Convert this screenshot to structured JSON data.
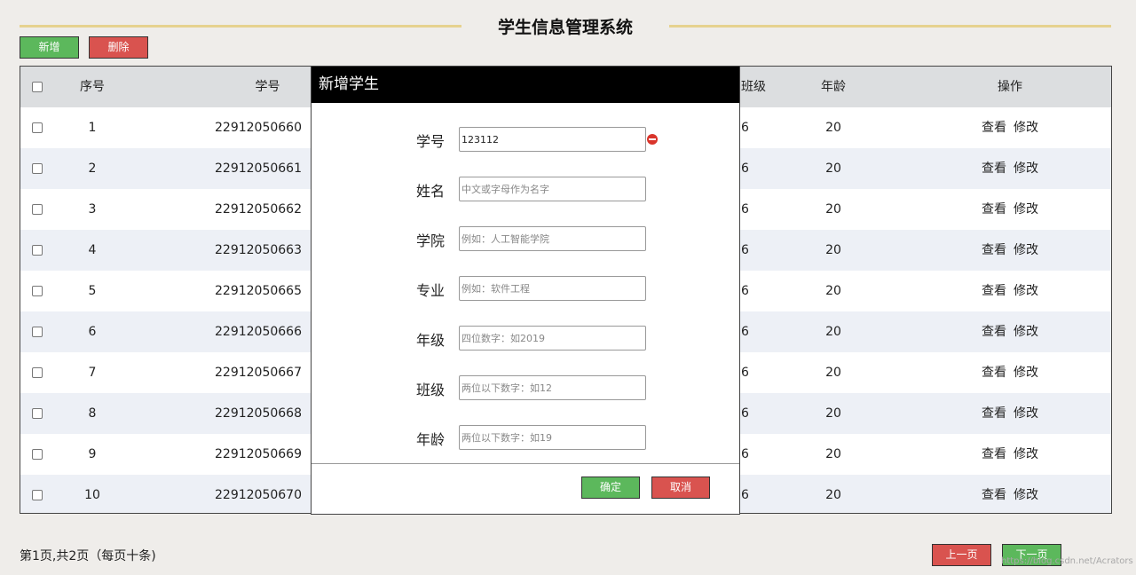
{
  "title": "学生信息管理系统",
  "toolbar": {
    "add_label": "新增",
    "delete_label": "删除"
  },
  "table": {
    "headers": {
      "seq": "序号",
      "student_id": "学号",
      "class": "班级",
      "age": "年龄",
      "ops": "操作"
    },
    "rows": [
      {
        "seq": "1",
        "student_id": "22912050660",
        "class": "6",
        "age": "20",
        "view": "查看",
        "edit": "修改"
      },
      {
        "seq": "2",
        "student_id": "22912050661",
        "class": "6",
        "age": "20",
        "view": "查看",
        "edit": "修改"
      },
      {
        "seq": "3",
        "student_id": "22912050662",
        "class": "6",
        "age": "20",
        "view": "查看",
        "edit": "修改"
      },
      {
        "seq": "4",
        "student_id": "22912050663",
        "class": "6",
        "age": "20",
        "view": "查看",
        "edit": "修改"
      },
      {
        "seq": "5",
        "student_id": "22912050665",
        "class": "6",
        "age": "20",
        "view": "查看",
        "edit": "修改"
      },
      {
        "seq": "6",
        "student_id": "22912050666",
        "class": "6",
        "age": "20",
        "view": "查看",
        "edit": "修改"
      },
      {
        "seq": "7",
        "student_id": "22912050667",
        "class": "6",
        "age": "20",
        "view": "查看",
        "edit": "修改"
      },
      {
        "seq": "8",
        "student_id": "22912050668",
        "class": "6",
        "age": "20",
        "view": "查看",
        "edit": "修改"
      },
      {
        "seq": "9",
        "student_id": "22912050669",
        "class": "6",
        "age": "20",
        "view": "查看",
        "edit": "修改"
      },
      {
        "seq": "10",
        "student_id": "22912050670",
        "class": "6",
        "age": "20",
        "view": "查看",
        "edit": "修改"
      }
    ]
  },
  "modal": {
    "title": "新增学生",
    "fields": [
      {
        "label": "学号",
        "value": "123112",
        "placeholder": ""
      },
      {
        "label": "姓名",
        "value": "",
        "placeholder": "中文或字母作为名字"
      },
      {
        "label": "学院",
        "value": "",
        "placeholder": "例如：人工智能学院"
      },
      {
        "label": "专业",
        "value": "",
        "placeholder": "例如：软件工程"
      },
      {
        "label": "年级",
        "value": "",
        "placeholder": "四位数字：如2019"
      },
      {
        "label": "班级",
        "value": "",
        "placeholder": "两位以下数字：如12"
      },
      {
        "label": "年龄",
        "value": "",
        "placeholder": "两位以下数字：如19"
      }
    ],
    "confirm_label": "确定",
    "cancel_label": "取消",
    "error_icon": "no-entry-icon"
  },
  "footer": {
    "page_info": "第1页,共2页（每页十条)",
    "prev_label": "上一页",
    "next_label": "下一页",
    "watermark": "https://blog.csdn.net/Acrators"
  },
  "colors": {
    "background": "#efedea",
    "accent_line": "#e6d28f",
    "green": "#5cb85c",
    "red": "#d9534f",
    "header_row": "#dcdee0",
    "alt_row": "#edf0f6"
  }
}
